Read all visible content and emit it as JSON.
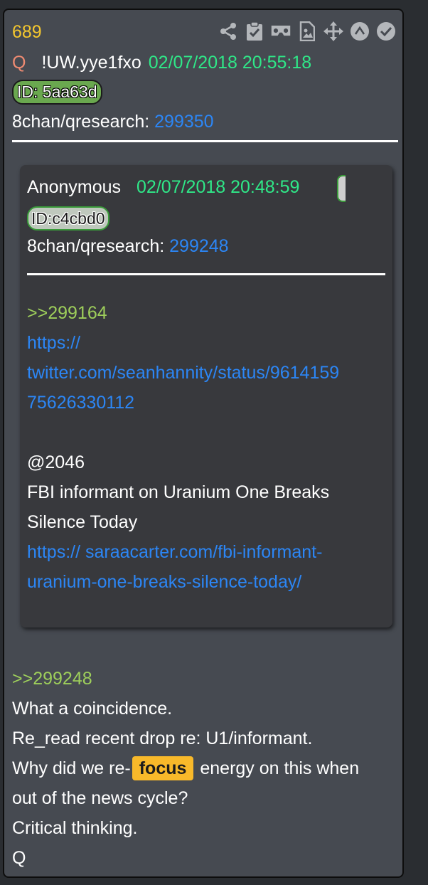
{
  "post": {
    "number": "689",
    "author_initial": "Q",
    "tripcode": "!UW.yye1fxo",
    "datetime": "02/07/2018 20:55:18",
    "id_label": "ID: 5aa63d",
    "board_prefix": "8chan/qresearch:",
    "board_post_num": "299350",
    "toolbar_icons": [
      "share-icon",
      "clipboard-check-icon",
      "vr-goggles-icon",
      "image-file-icon",
      "move-arrows-icon",
      "caret-up-circle-icon",
      "check-circle-icon"
    ]
  },
  "quoted": {
    "author": "Anonymous",
    "datetime": "02/07/2018 20:48:59",
    "id_label": "ID:c4cbd0",
    "board_prefix": "8chan/qresearch:",
    "board_post_num": "299248",
    "reply_ref": ">>299164",
    "link1_lines": [
      "https://",
      "twitter.com/seanhannity/status/9614159",
      "75626330112"
    ],
    "mention": "@2046",
    "text_lines": [
      "FBI informant on Uranium One Breaks",
      "Silence Today"
    ],
    "link2_lines": [
      "https:// saraacarter.com/fbi-informant-",
      "uranium-one-breaks-silence-today/"
    ]
  },
  "body": {
    "reply_ref": ">>299248",
    "line1": "What a coincidence.",
    "line2": "Re_read recent drop re: U1/informant.",
    "line3_before": "Why did we re-",
    "line3_highlight": "focus",
    "line3_after": "energy on this when",
    "line4": "out of the news cycle?",
    "line5": "Critical thinking.",
    "line6": "Q"
  },
  "colors": {
    "post_number": "#f4c72e",
    "author_initial": "#ef8b72",
    "datetime": "#2fe888",
    "link": "#2c86f5",
    "reply_ref": "#9ecf5b",
    "highlight": "#f8b92a",
    "id_badge": "#6aa84f"
  }
}
